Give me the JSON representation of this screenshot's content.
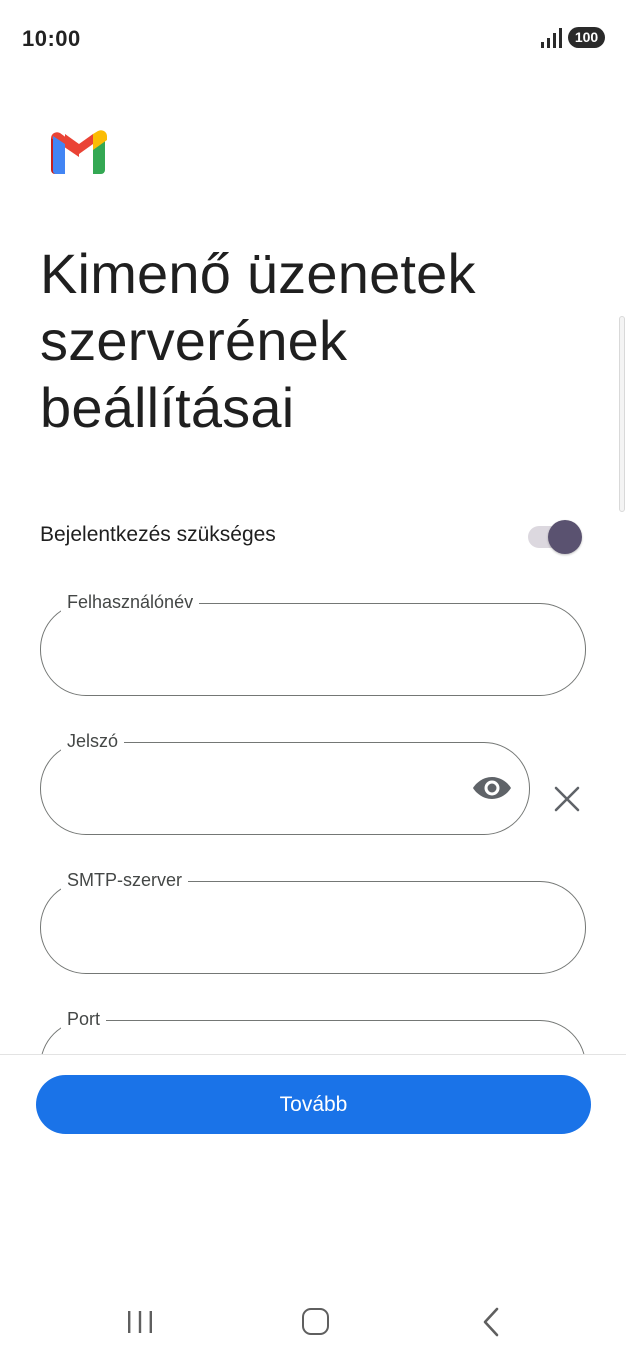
{
  "status_bar": {
    "time": "10:00",
    "battery": "100",
    "signal_icon": "signal-bars-icon"
  },
  "logo": {
    "icon": "gmail-logo"
  },
  "page": {
    "title_line1": "Kimenő üzenetek",
    "title_line2": "szerverének",
    "title_line3": "beállításai"
  },
  "signin_required": {
    "label": "Bejelentkezés szükséges",
    "enabled": true,
    "accent": "#5a5270"
  },
  "fields": {
    "username": {
      "label": "Felhasználónév",
      "value": ""
    },
    "password": {
      "label": "Jelszó",
      "value": "",
      "show_icon": "eye-icon",
      "clear_icon": "close-icon"
    },
    "smtp_server": {
      "label": "SMTP-szerver",
      "value": ""
    },
    "port": {
      "label": "Port",
      "value": ""
    }
  },
  "actions": {
    "next_label": "Tovább",
    "next_color": "#1a73e8"
  },
  "nav_bar": {
    "recent_icon": "recent-apps-icon",
    "home_icon": "home-icon",
    "back_icon": "back-icon"
  }
}
